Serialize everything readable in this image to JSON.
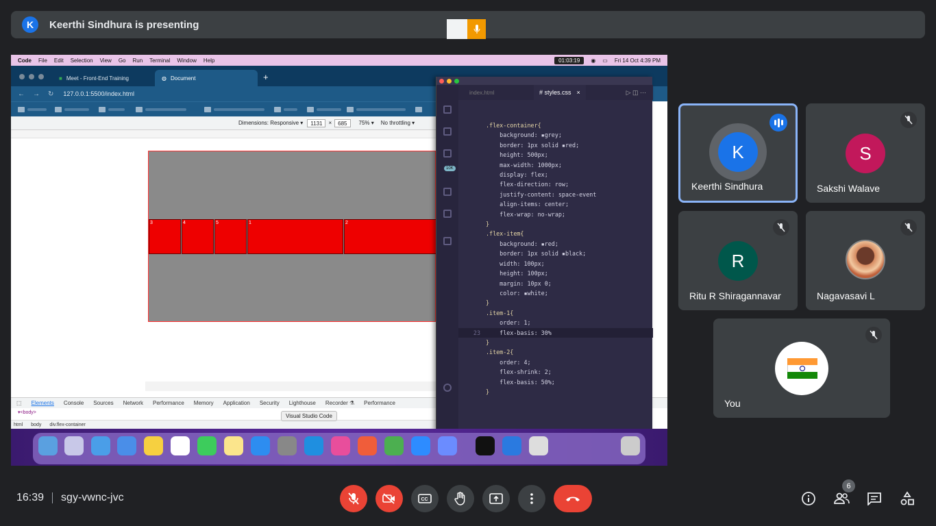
{
  "banner": {
    "avatar": "K",
    "text": "Keerthi Sindhura is presenting"
  },
  "shared_screen": {
    "menubar": {
      "apple": "",
      "items": [
        "Code",
        "File",
        "Edit",
        "Selection",
        "View",
        "Go",
        "Run",
        "Terminal",
        "Window",
        "Help"
      ],
      "timer": "01:03:19",
      "datetime": "Fri 14 Oct  4:39 PM"
    },
    "browser": {
      "tabs": [
        "Meet - Front-End Training",
        "Document"
      ],
      "url": "127.0.0.1:5500/index.html",
      "dimensions_label": "Dimensions: Responsive ▾",
      "width": "1131",
      "height": "685",
      "zoom": "75% ▾",
      "throttling": "No throttling ▾",
      "flex_items": [
        "3",
        "4",
        "5",
        "1",
        "2"
      ],
      "devtools_tabs": [
        "Elements",
        "Console",
        "Sources",
        "Network",
        "Performance",
        "Memory",
        "Application",
        "Security",
        "Lighthouse",
        "Recorder ⚗",
        "Performance"
      ],
      "devtools_code": "▾<body>",
      "breadcrumbs": [
        "html",
        "body",
        "div.flex-container"
      ],
      "dock_tooltip": "Visual Studio Code"
    },
    "vscode": {
      "tab_inactive": "index.html",
      "tab_active": "# styles.css",
      "tab_close": "×",
      "lines": [
        {
          "no": "",
          "text": ".flex-container{",
          "kind": "selector"
        },
        {
          "no": "",
          "text": "    background: ▪grey;",
          "kind": "prop"
        },
        {
          "no": "",
          "text": "    border: 1px solid ▪red;",
          "kind": "prop"
        },
        {
          "no": "",
          "text": "    height: 500px;",
          "kind": "prop"
        },
        {
          "no": "",
          "text": "    max-width: 1000px;",
          "kind": "prop"
        },
        {
          "no": "",
          "text": "    display: flex;",
          "kind": "prop"
        },
        {
          "no": "",
          "text": "    flex-direction: row;",
          "kind": "prop"
        },
        {
          "no": "",
          "text": "    justify-content: space-event",
          "kind": "prop"
        },
        {
          "no": "",
          "text": "    align-items: center;",
          "kind": "prop"
        },
        {
          "no": "",
          "text": "    flex-wrap: no-wrap;",
          "kind": "prop"
        },
        {
          "no": "",
          "text": "}",
          "kind": "brace"
        },
        {
          "no": "",
          "text": ".flex-item{",
          "kind": "selector"
        },
        {
          "no": "",
          "text": "    background: ▪red;",
          "kind": "prop"
        },
        {
          "no": "",
          "text": "    border: 1px solid ▪black;",
          "kind": "prop"
        },
        {
          "no": "",
          "text": "    width: 100px;",
          "kind": "prop"
        },
        {
          "no": "",
          "text": "    height: 100px;",
          "kind": "prop"
        },
        {
          "no": "",
          "text": "    margin: 10px 0;",
          "kind": "prop"
        },
        {
          "no": "",
          "text": "    color: ▪white;",
          "kind": "prop"
        },
        {
          "no": "",
          "text": "}",
          "kind": "brace"
        },
        {
          "no": "",
          "text": ".item-1{",
          "kind": "selector"
        },
        {
          "no": "",
          "text": "    order: 1;",
          "kind": "prop"
        },
        {
          "no": "",
          "text": "",
          "kind": "prop"
        },
        {
          "no": "23",
          "text": "    flex-basis: 30%",
          "kind": "current"
        },
        {
          "no": "",
          "text": "}",
          "kind": "brace"
        },
        {
          "no": "",
          "text": ".item-2{",
          "kind": "selector"
        },
        {
          "no": "",
          "text": "    order: 4;",
          "kind": "prop"
        },
        {
          "no": "",
          "text": "    flex-shrink: 2;",
          "kind": "prop"
        },
        {
          "no": "",
          "text": "    flex-basis: 50%;",
          "kind": "prop"
        },
        {
          "no": "",
          "text": "}",
          "kind": "brace"
        }
      ],
      "badge": "10K"
    }
  },
  "participants": [
    {
      "name": "Keerthi Sindhura",
      "initial": "K",
      "color": "#1a73e8",
      "speaking": true
    },
    {
      "name": "Sakshi Walave",
      "initial": "S",
      "color": "#c2185b",
      "muted": true
    },
    {
      "name": "Ritu R Shiragannavar",
      "initial": "R",
      "color": "#00574b",
      "muted": true
    },
    {
      "name": "Nagavasavi L",
      "initial": "",
      "color": "#c8745a",
      "muted": true
    },
    {
      "name": "You",
      "initial": "",
      "color": "#ffffff",
      "muted": true
    }
  ],
  "footer": {
    "time": "16:39",
    "meeting_code": "sgy-vwnc-jvc",
    "people_count": "6"
  },
  "colors": {
    "background": "#202124",
    "tile": "#3c4043",
    "danger": "#ea4335",
    "accent": "#8ab4f8"
  }
}
